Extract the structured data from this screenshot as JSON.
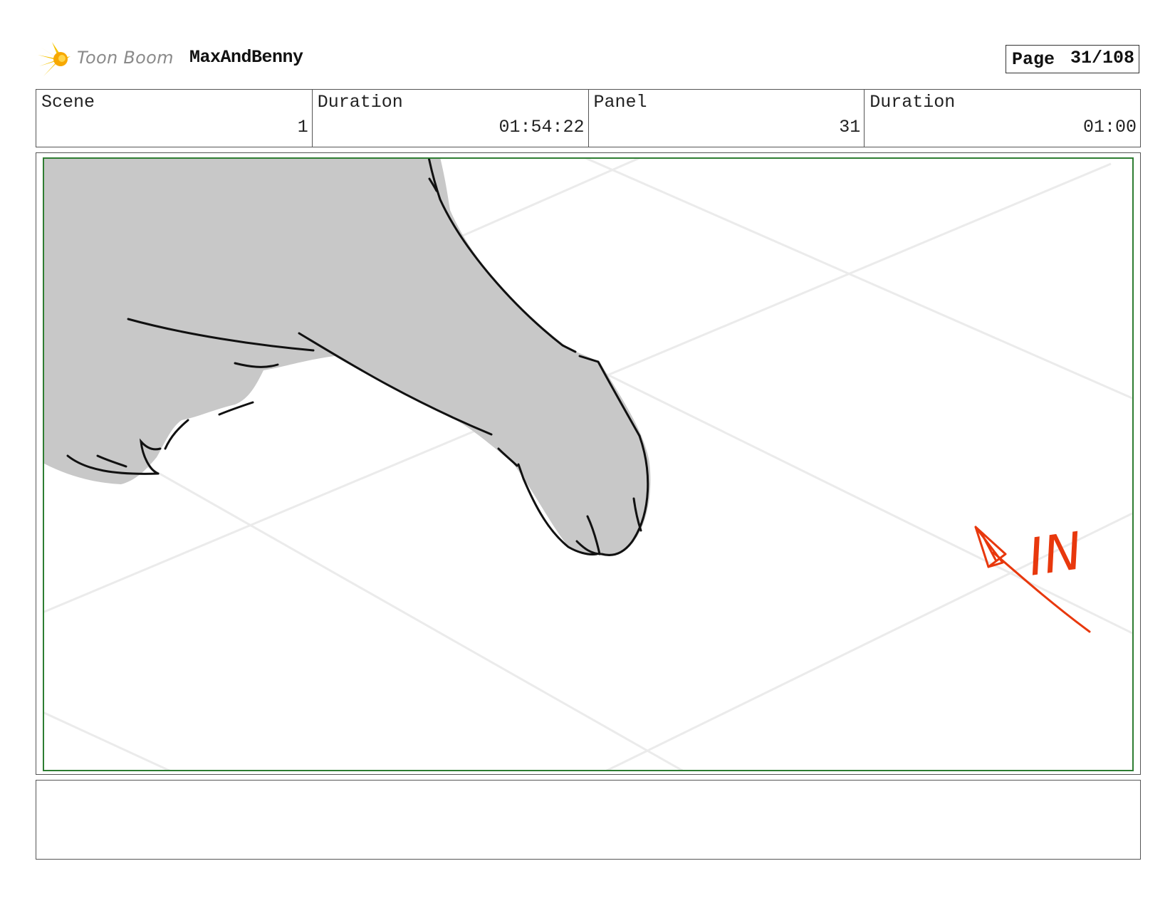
{
  "header": {
    "brand": "Toon Boom",
    "project": "MaxAndBenny",
    "page_label": "Page",
    "page_value": "31/108"
  },
  "info": {
    "scene_label": "Scene",
    "scene_value": "1",
    "scene_duration_label": "Duration",
    "scene_duration_value": "01:54:22",
    "panel_label": "Panel",
    "panel_value": "31",
    "panel_duration_label": "Duration",
    "panel_duration_value": "01:00"
  },
  "panel": {
    "annotation_text": "IN",
    "annotation_color": "#e8380d",
    "frame_color": "#2e7d32",
    "fill_color": "#c8c8c8"
  },
  "notes": {
    "text": ""
  }
}
